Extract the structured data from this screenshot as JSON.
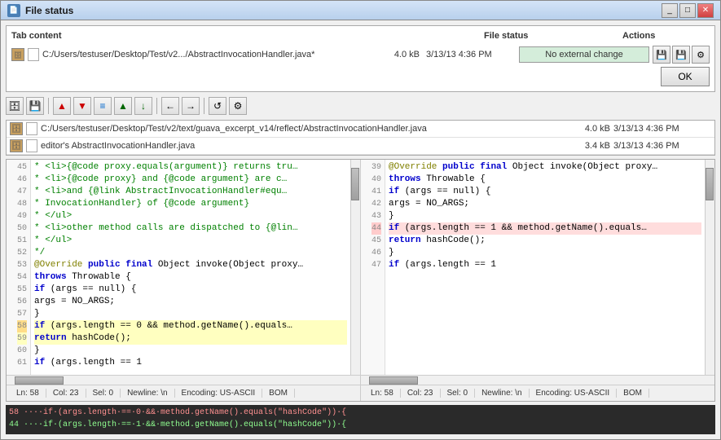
{
  "window": {
    "title": "File status",
    "titleIcon": "📄"
  },
  "panel": {
    "tabContentLabel": "Tab content",
    "fileStatusLabel": "File status",
    "actionsLabel": "Actions"
  },
  "fileEntry": {
    "icon": "🗄",
    "path": "C:/Users/testuser/Desktop/Test/v2.../AbstractInvocationHandler.java*",
    "size": "4.0 kB",
    "date": "3/13/13 4:36 PM",
    "statusText": "No external change",
    "statusClass": "status-no-change"
  },
  "okButton": "OK",
  "toolbar": {
    "buttons": [
      "🗄",
      "💾",
      "▲",
      "▼",
      "≡",
      "▲",
      "↓",
      "←",
      "→",
      "↺",
      "⚙"
    ]
  },
  "editorFiles": [
    {
      "icon": "🗄",
      "path": "C:/Users/testuser/Desktop/Test/v2/text/guava_excerpt_v14/reflect/AbstractInvocationHandler.java",
      "size": "4.0 kB",
      "date": "3/13/13 4:36 PM"
    },
    {
      "icon": "🗄",
      "path": "editor's AbstractInvocationHandler.java",
      "size": "3.4 kB",
      "date": "3/13/13 4:36 PM"
    }
  ],
  "leftEditor": {
    "lineNumbers": [
      45,
      46,
      47,
      48,
      49,
      50,
      51,
      52,
      53,
      54,
      55,
      56,
      57,
      58,
      59,
      60,
      61
    ],
    "lines": [
      " *   <li>{@code proxy.equals(argument)} returns tru...",
      " *   <li>{@code proxy} and {@code argument} are c...",
      " *   <li>and {@link AbstractInvocationHandler#equ...",
      " *       InvocationHandler} of {@code argument}",
      " * </ul>",
      " * <li>other method calls are dispatched to {@lin...",
      " * </ul>",
      " */",
      "@Override public final Object invoke(Object proxy...",
      "    throws Throwable {",
      "  if (args == null) {",
      "    args = NO_ARGS;",
      "  }",
      "  if (args.length == 0 && method.getName().equals...",
      "    return hashCode();",
      "  }",
      "  if (args.length == 1"
    ],
    "highlights": {
      "13": "yellow",
      "14": "yellow"
    }
  },
  "rightEditor": {
    "lineNumbers": [
      39,
      40,
      41,
      42,
      43,
      44,
      45,
      46,
      47
    ],
    "lines": [
      "@Override public final Object invoke(Object proxy...",
      "    throws Throwable {",
      "  if (args == null) {",
      "    args = NO_ARGS;",
      "  }",
      "  if (args.length == 1 && method.getName().equals...",
      "    return hashCode();",
      "  }",
      "  if (args.length == 1"
    ],
    "highlights": {
      "5": "red"
    }
  },
  "leftStatus": {
    "ln": "Ln: 58",
    "col": "Col: 23",
    "sel": "Sel: 0",
    "newline": "Newline: \\n",
    "encoding": "Encoding: US-ASCII",
    "bom": "BOM"
  },
  "rightStatus": {
    "ln": "Ln: 58",
    "col": "Col: 23",
    "sel": "Sel: 0",
    "newline": "Newline: \\n",
    "encoding": "Encoding: US-ASCII",
    "bom": "BOM"
  },
  "diffLines": [
    "58 ····if·(args.length·==·0·&&·method.getName().equals(\"hashCode\"))·{",
    "44 ····if·(args.length·==·1·&&·method.getName().equals(\"hashCode\"))·{"
  ]
}
